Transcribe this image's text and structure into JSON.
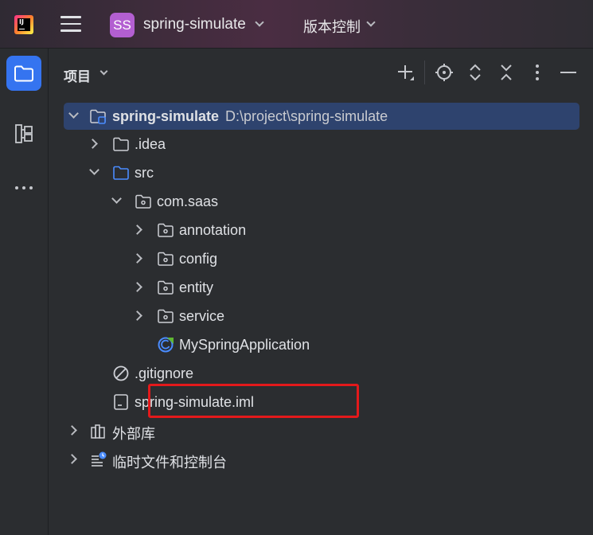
{
  "titlebar": {
    "project_badge": "SS",
    "project_name": "spring-simulate",
    "vcs_label": "版本控制"
  },
  "panel": {
    "title": "项目",
    "toolbar_icons": [
      "add-icon",
      "locate-icon",
      "expand-all-icon",
      "collapse-all-icon",
      "more-options-icon",
      "hide-icon"
    ]
  },
  "sidebar": {
    "items": [
      "project-icon",
      "structure-icon",
      "more-icon"
    ]
  },
  "tree": {
    "root_name": "spring-simulate",
    "root_path": "D:\\project\\spring-simulate",
    "idea": ".idea",
    "src": "src",
    "pkg": "com.saas",
    "annotation": "annotation",
    "config": "config",
    "entity": "entity",
    "service": "service",
    "main_class": "MySpringApplication",
    "gitignore": ".gitignore",
    "iml": "spring-simulate.iml",
    "external_libs": "外部库",
    "scratches": "临时文件和控制台"
  },
  "colors": {
    "accent": "#3574f0",
    "selection": "#2e436e",
    "highlight_box": "#e3191b",
    "badge": "#b35fd1"
  }
}
